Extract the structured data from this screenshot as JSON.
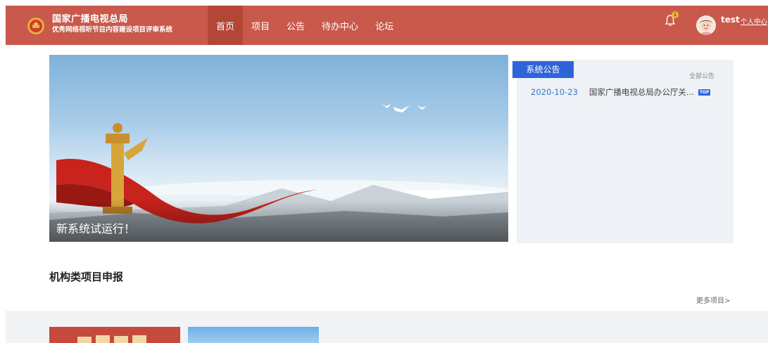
{
  "header": {
    "org_name": "国家广播电视总局",
    "system_name": "优秀网络视听节目内容建设项目评审系统",
    "nav": [
      {
        "label": "首页",
        "active": true
      },
      {
        "label": "项目",
        "active": false
      },
      {
        "label": "公告",
        "active": false
      },
      {
        "label": "待办中心",
        "active": false
      },
      {
        "label": "论坛",
        "active": false
      }
    ],
    "notification_count": "1",
    "username": "test",
    "user_center": "个人中心"
  },
  "banner": {
    "caption": "新系统试运行！"
  },
  "notice_panel": {
    "tab_label": "系统公告",
    "all_link": "全部公告",
    "items": [
      {
        "date": "2020-10-23",
        "title": "国家广播电视总局办公厅关...",
        "badge": "TOP"
      }
    ]
  },
  "projects": {
    "section_title": "机构类项目申报",
    "more_link": "更多项目>"
  },
  "colors": {
    "header_bg": "#c9594b",
    "nav_active_bg": "#b44638",
    "accent_blue": "#2f64d9",
    "date_blue": "#3a78c8"
  }
}
